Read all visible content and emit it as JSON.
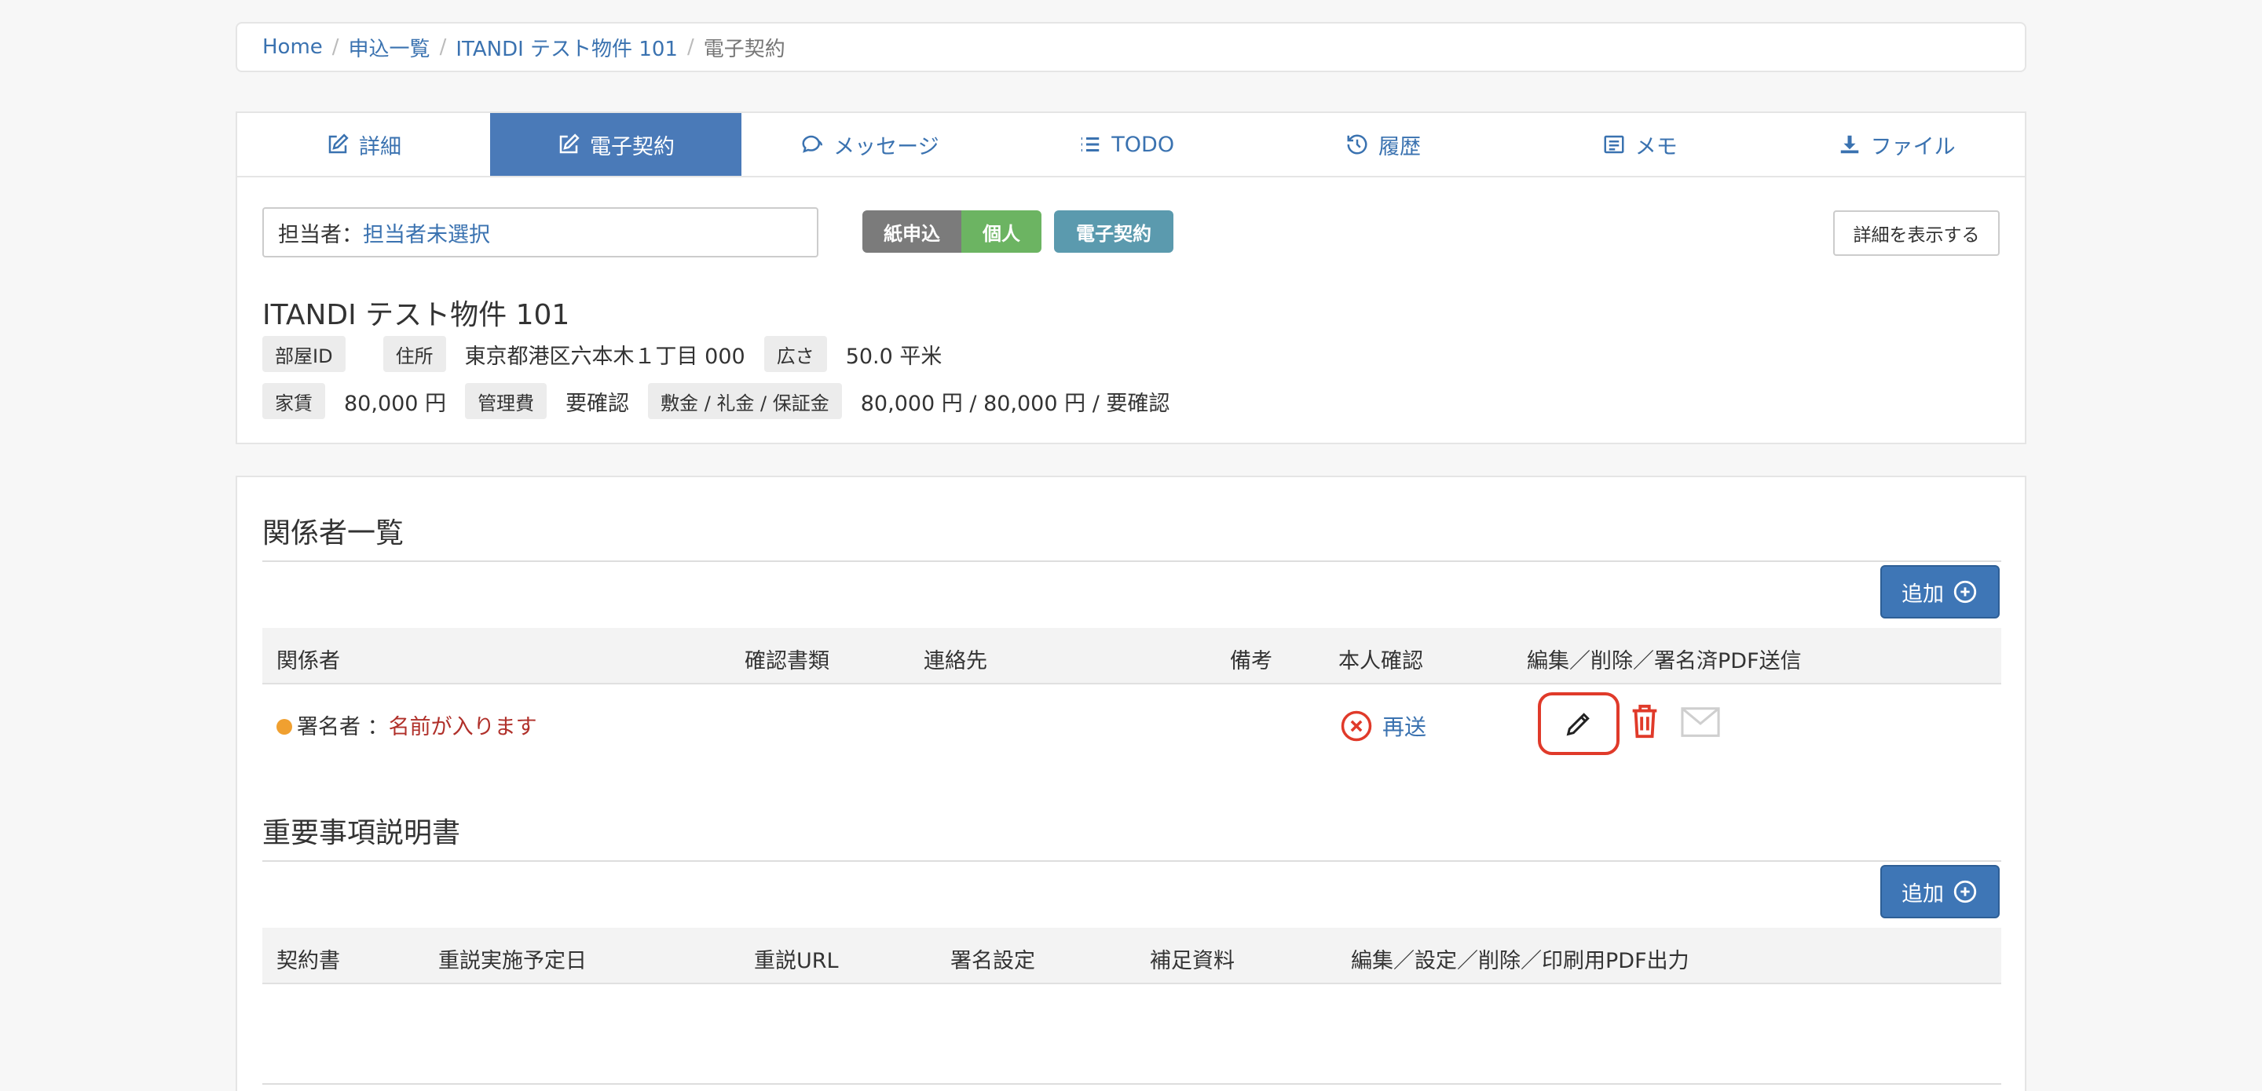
{
  "breadcrumb": {
    "home": "Home",
    "list": "申込一覧",
    "property": "ITANDI テスト物件 101",
    "current": "電子契約",
    "sep": "/"
  },
  "tabs": [
    {
      "label": "詳細",
      "icon": "edit-icon"
    },
    {
      "label": "電子契約",
      "icon": "edit-icon"
    },
    {
      "label": "メッセージ",
      "icon": "chat-icon"
    },
    {
      "label": "TODO",
      "icon": "list-icon"
    },
    {
      "label": "履歴",
      "icon": "history-icon"
    },
    {
      "label": "メモ",
      "icon": "memo-icon"
    },
    {
      "label": "ファイル",
      "icon": "download-icon"
    }
  ],
  "assignee": {
    "label": "担当者：",
    "value": "担当者未選択"
  },
  "badges": {
    "paper": "紙申込",
    "individual": "個人",
    "econtract": "電子契約"
  },
  "detail_button": "詳細を表示する",
  "property": {
    "title": "ITANDI テスト物件 101",
    "room_id_label": "部屋ID",
    "room_id_value": "",
    "address_label": "住所",
    "address_value": "東京都港区六本木１丁目 000",
    "size_label": "広さ",
    "size_value": "50.0 平米",
    "rent_label": "家賃",
    "rent_value": "80,000 円",
    "mgmt_label": "管理費",
    "mgmt_value": "要確認",
    "deposit_label": "敷金 / 礼金 / 保証金",
    "deposit_value": "80,000 円 / 80,000 円 / 要確認"
  },
  "parties": {
    "title": "関係者一覧",
    "add_label": "追加",
    "columns": [
      "関係者",
      "確認書類",
      "連絡先",
      "備考",
      "本人確認",
      "編集／削除／署名済PDF送信"
    ],
    "row": {
      "role": "署名者 ：",
      "name": "名前が入ります",
      "resend": "再送"
    }
  },
  "important": {
    "title": "重要事項説明書",
    "add_label": "追加",
    "columns": [
      "契約書",
      "重説実施予定日",
      "重説URL",
      "署名設定",
      "補足資料",
      "編集／設定／削除／印刷用PDF出力"
    ]
  },
  "colors": {
    "accent": "#4a7ab8",
    "link": "#3a72b0",
    "danger": "#e03a2a",
    "status_dot": "#f0a030"
  }
}
